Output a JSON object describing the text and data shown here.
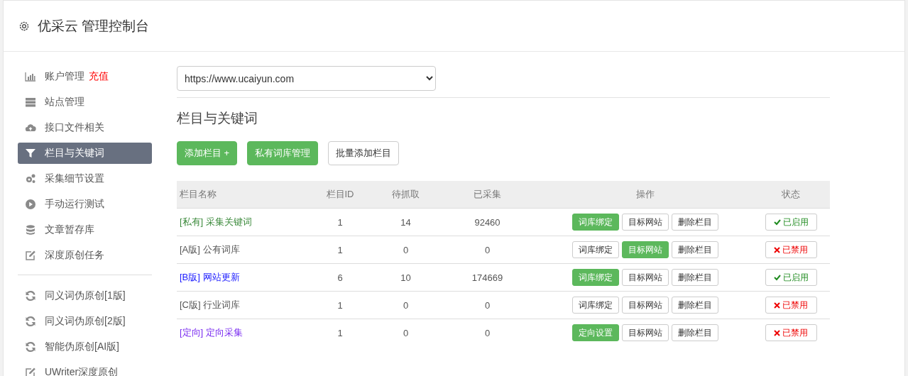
{
  "header": {
    "title": "优采云 管理控制台"
  },
  "sidebar": {
    "items": [
      {
        "kind": "chart",
        "label": "账户管理",
        "badge": "充值",
        "selected": false
      },
      {
        "kind": "server",
        "label": "站点管理",
        "selected": false
      },
      {
        "kind": "cloud",
        "label": "接口文件相关",
        "selected": false
      },
      {
        "kind": "filter",
        "label": "栏目与关键词",
        "selected": true
      },
      {
        "kind": "gears",
        "label": "采集细节设置",
        "selected": false
      },
      {
        "kind": "play",
        "label": "手动运行测试",
        "selected": false
      },
      {
        "kind": "database",
        "label": "文章暂存库",
        "selected": false
      },
      {
        "kind": "edit",
        "label": "深度原创任务",
        "selected": false
      }
    ],
    "tools": [
      {
        "kind": "refresh",
        "label": "同义词伪原创[1版]",
        "selected": false
      },
      {
        "kind": "refresh",
        "label": "同义词伪原创[2版]",
        "selected": false
      },
      {
        "kind": "refresh",
        "label": "智能伪原创[AI版]",
        "selected": false
      },
      {
        "kind": "edit",
        "label": "UWriter深度原创",
        "selected": false
      }
    ]
  },
  "site_select": {
    "value": "https://www.ucaiyun.com"
  },
  "section": {
    "title": "栏目与关键词",
    "buttons": [
      {
        "label": "添加栏目 +",
        "kind": "primary"
      },
      {
        "label": "私有词库管理",
        "kind": "primary"
      },
      {
        "label": "批量添加栏目",
        "kind": "default"
      }
    ]
  },
  "table": {
    "columns": [
      "栏目名称",
      "栏目ID",
      "待抓取",
      "已采集",
      "操作",
      "状态"
    ],
    "rows": [
      {
        "name": "[私有] 采集关键词",
        "color": "#3c8a3c",
        "id": "1",
        "pending": "14",
        "collected": "92460",
        "actions": [
          {
            "label": "词库绑定",
            "primary": true
          },
          {
            "label": "目标网站",
            "primary": false
          },
          {
            "label": "删除栏目",
            "primary": false
          }
        ],
        "status": {
          "label": "已启用",
          "enabled": true
        }
      },
      {
        "name": "[A版] 公有词库",
        "color": "#555555",
        "id": "1",
        "pending": "0",
        "collected": "0",
        "actions": [
          {
            "label": "词库绑定",
            "primary": false
          },
          {
            "label": "目标网站",
            "primary": true
          },
          {
            "label": "删除栏目",
            "primary": false
          }
        ],
        "status": {
          "label": "已禁用",
          "enabled": false
        }
      },
      {
        "name": "[B版] 网站更新",
        "color": "#1a1aff",
        "id": "6",
        "pending": "10",
        "collected": "174669",
        "actions": [
          {
            "label": "词库绑定",
            "primary": true
          },
          {
            "label": "目标网站",
            "primary": false
          },
          {
            "label": "删除栏目",
            "primary": false
          }
        ],
        "status": {
          "label": "已启用",
          "enabled": true
        }
      },
      {
        "name": "[C版] 行业词库",
        "color": "#555555",
        "id": "1",
        "pending": "0",
        "collected": "0",
        "actions": [
          {
            "label": "词库绑定",
            "primary": false
          },
          {
            "label": "目标网站",
            "primary": false
          },
          {
            "label": "删除栏目",
            "primary": false
          }
        ],
        "status": {
          "label": "已禁用",
          "enabled": false
        }
      },
      {
        "name": "[定向] 定向采集",
        "color": "#7a2cf0",
        "id": "1",
        "pending": "0",
        "collected": "0",
        "actions": [
          {
            "label": "定向设置",
            "primary": true
          },
          {
            "label": "目标网站",
            "primary": false
          },
          {
            "label": "删除栏目",
            "primary": false
          }
        ],
        "status": {
          "label": "已禁用",
          "enabled": false
        }
      }
    ]
  }
}
